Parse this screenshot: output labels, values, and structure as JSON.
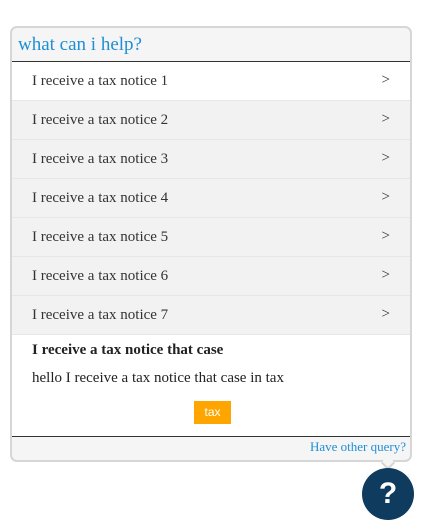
{
  "widget": {
    "title": "what can i help?",
    "items": [
      {
        "label": "I receive a tax notice 1",
        "arrow": ">"
      },
      {
        "label": "I receive a tax notice 2",
        "arrow": ">"
      },
      {
        "label": "I receive a tax notice 3",
        "arrow": ">"
      },
      {
        "label": "I receive a tax notice 4",
        "arrow": ">"
      },
      {
        "label": "I receive a tax notice 5",
        "arrow": ">"
      },
      {
        "label": "I receive a tax notice 6",
        "arrow": ">"
      },
      {
        "label": "I receive a tax notice 7",
        "arrow": ">"
      }
    ],
    "answer": {
      "title": "I receive a tax notice that case",
      "body": "hello I receive a tax notice that case in tax",
      "tag": "tax"
    },
    "footer_link": "Have other query?"
  },
  "help_button": {
    "glyph": "?",
    "icon": "question-mark-icon"
  },
  "colors": {
    "accent_blue": "#1e8fd6",
    "tag_orange": "#ffa500",
    "help_navy": "#0e3b5e",
    "row_gray": "#f2f2f2"
  }
}
